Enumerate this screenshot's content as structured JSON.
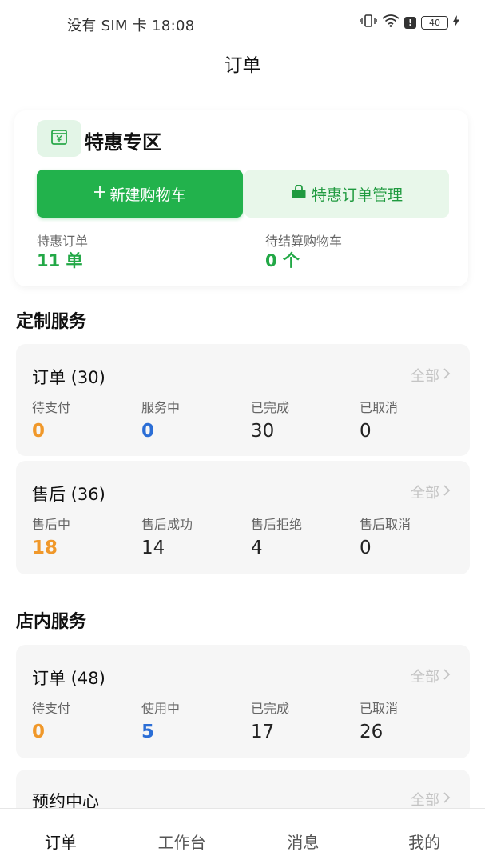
{
  "status_bar": {
    "left_text": "没有 SIM 卡 18:08",
    "battery": "40"
  },
  "nav": {
    "title": "订单"
  },
  "promo": {
    "title": "特惠专区",
    "new_cart_button": "新建购物车",
    "manage_button": "特惠订单管理",
    "stats": [
      {
        "label": "特惠订单",
        "value": "11 单"
      },
      {
        "label": "待结算购物车",
        "value": "0 个"
      }
    ]
  },
  "custom_service": {
    "section_title": "定制服务",
    "orders": {
      "title": "订单 (30)",
      "all_label": "全部",
      "items": [
        {
          "label": "待支付",
          "value": "0"
        },
        {
          "label": "服务中",
          "value": "0"
        },
        {
          "label": "已完成",
          "value": "30"
        },
        {
          "label": "已取消",
          "value": "0"
        }
      ]
    },
    "after_sales": {
      "title": "售后 (36)",
      "all_label": "全部",
      "items": [
        {
          "label": "售后中",
          "value": "18"
        },
        {
          "label": "售后成功",
          "value": "14"
        },
        {
          "label": "售后拒绝",
          "value": "4"
        },
        {
          "label": "售后取消",
          "value": "0"
        }
      ]
    }
  },
  "store_service": {
    "section_title": "店内服务",
    "orders": {
      "title": "订单 (48)",
      "all_label": "全部",
      "items": [
        {
          "label": "待支付",
          "value": "0"
        },
        {
          "label": "使用中",
          "value": "5"
        },
        {
          "label": "已完成",
          "value": "17"
        },
        {
          "label": "已取消",
          "value": "26"
        }
      ]
    },
    "appointment": {
      "title": "预约中心",
      "all_label": "全部"
    }
  },
  "tabbar": {
    "items": [
      {
        "label": "订单"
      },
      {
        "label": "工作台"
      },
      {
        "label": "消息"
      },
      {
        "label": "我的"
      }
    ]
  }
}
